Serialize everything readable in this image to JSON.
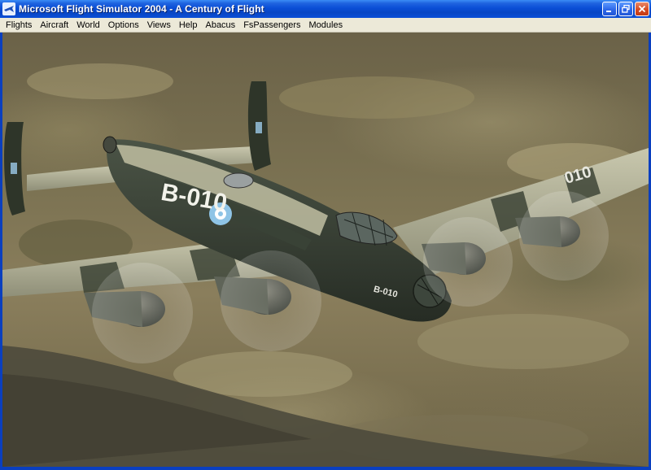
{
  "window": {
    "title": "Microsoft Flight Simulator 2004 - A Century of Flight"
  },
  "menu": {
    "items": [
      {
        "label": "Flights"
      },
      {
        "label": "Aircraft"
      },
      {
        "label": "World"
      },
      {
        "label": "Options"
      },
      {
        "label": "Views"
      },
      {
        "label": "Help"
      },
      {
        "label": "Abacus"
      },
      {
        "label": "FsPassengers"
      },
      {
        "label": "Modules"
      }
    ]
  },
  "scene": {
    "aircraft_marking": "B-010",
    "wing_marking": "010",
    "colors": {
      "fuselage_dark": "#3a4236",
      "fuselage_light": "#b9b89c",
      "roundel_outer": "#8fc4e6",
      "roundel_inner": "#ffffff"
    }
  }
}
